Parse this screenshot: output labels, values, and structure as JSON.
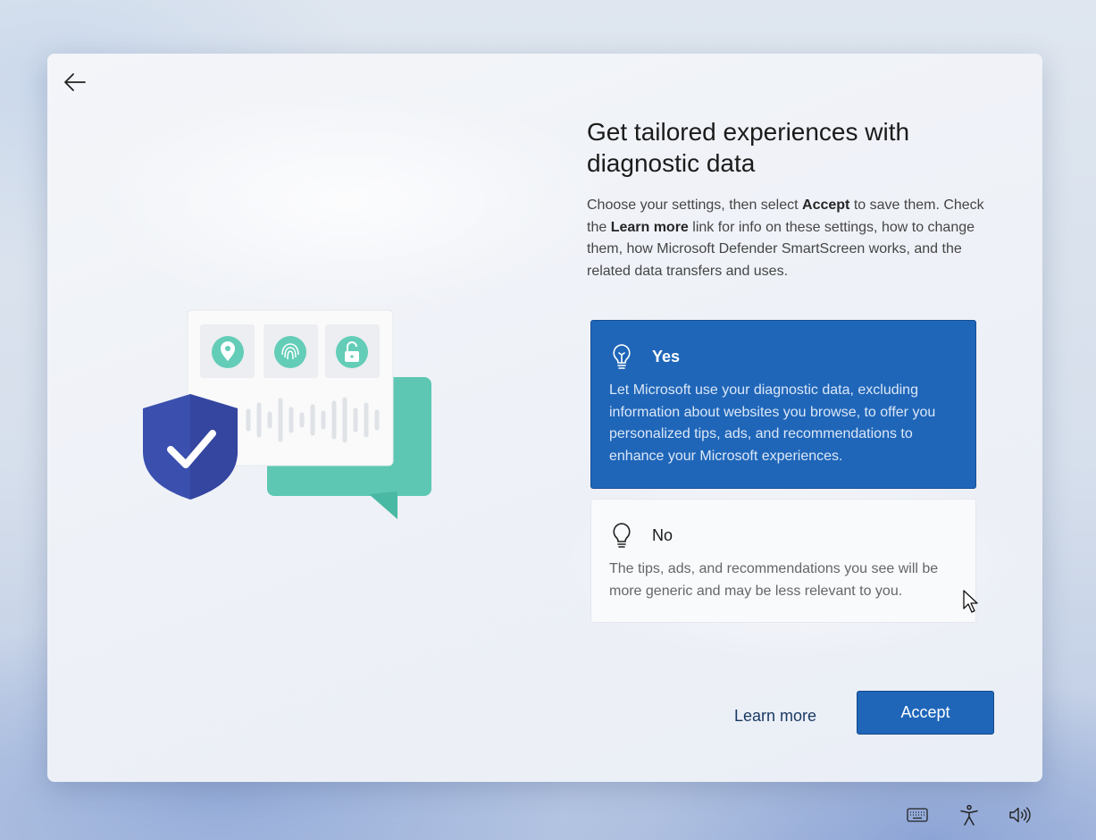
{
  "header": {
    "title": "Get tailored experiences with diagnostic data"
  },
  "description": {
    "part1": "Choose your settings, then select ",
    "accept_bold": "Accept",
    "part2": " to save them. Check the ",
    "learn_more_bold": "Learn more",
    "part3": " link for info on these settings, how to change them, how Microsoft Defender SmartScreen works, and the related data transfers and uses."
  },
  "options": [
    {
      "label": "Yes",
      "description": "Let Microsoft use your diagnostic data, excluding information about websites you browse, to offer you personalized tips, ads, and recommendations to enhance your Microsoft experiences.",
      "icon": "lightbulb-on-icon",
      "selected": true
    },
    {
      "label": "No",
      "description": "The tips, ads, and recommendations you see will be more generic and may be less relevant to you.",
      "icon": "lightbulb-off-icon",
      "selected": false
    }
  ],
  "footer": {
    "learn_more_label": "Learn more",
    "accept_label": "Accept"
  },
  "tray_icons": [
    "keyboard-icon",
    "accessibility-icon",
    "volume-icon"
  ],
  "colors": {
    "accent": "#1f66b9",
    "shield": "#3a4fae",
    "teal": "#4fc3ad"
  }
}
